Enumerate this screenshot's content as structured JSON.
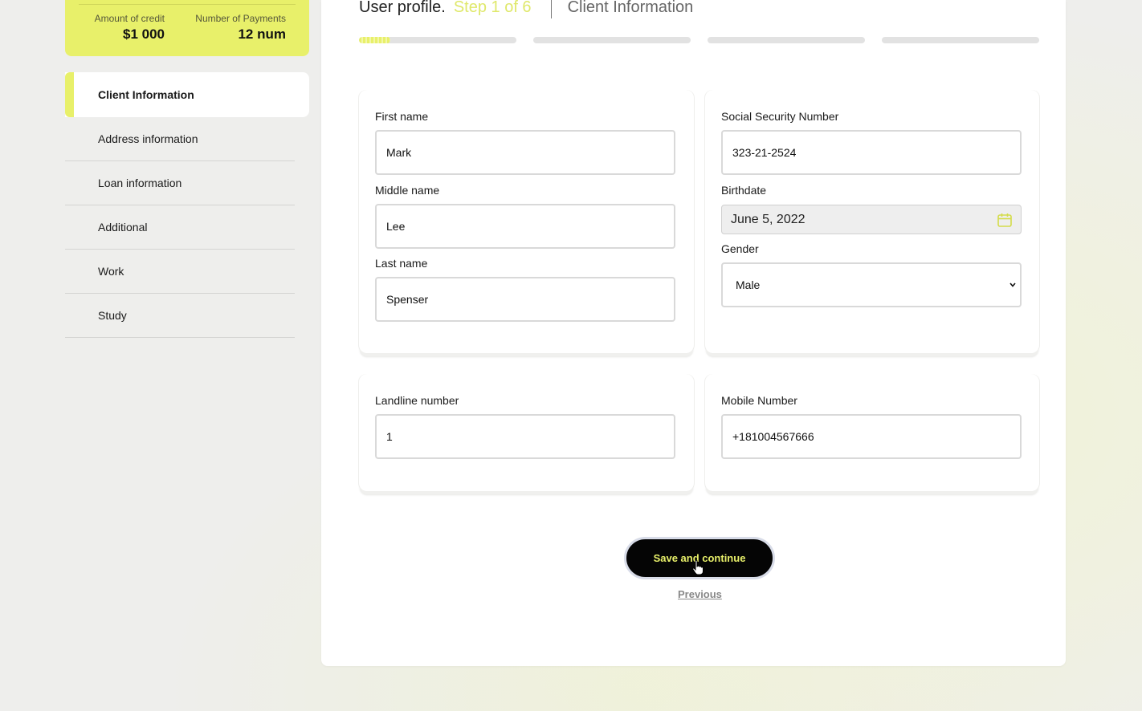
{
  "summary": {
    "amount_label": "Amount of credit",
    "amount_value": "$1 000",
    "payments_label": "Number of Payments",
    "payments_value": "12 num"
  },
  "sidebar": {
    "items": [
      {
        "label": "Client Information",
        "active": true
      },
      {
        "label": "Address information"
      },
      {
        "label": "Loan information"
      },
      {
        "label": "Additional"
      },
      {
        "label": "Work"
      },
      {
        "label": "Study"
      }
    ]
  },
  "header": {
    "title": "User profile.",
    "step": "Step 1 of 6",
    "section": "Client Information"
  },
  "progress": {
    "segments": 4,
    "current_fraction": 0.2
  },
  "form": {
    "first_name": {
      "label": "First name",
      "value": "Mark"
    },
    "middle_name": {
      "label": "Middle name",
      "value": "Lee"
    },
    "last_name": {
      "label": "Last name",
      "value": "Spenser"
    },
    "ssn": {
      "label": "Social Security Number",
      "value": "323-21-2524"
    },
    "birthdate": {
      "label": "Birthdate",
      "value": "June 5, 2022"
    },
    "gender": {
      "label": "Gender",
      "value": "Male"
    },
    "landline": {
      "label": "Landline number",
      "value": "1"
    },
    "mobile": {
      "label": "Mobile Number",
      "value": "+181004567666"
    }
  },
  "actions": {
    "save_label": "Save and continue",
    "previous_label": "Previous"
  },
  "colors": {
    "accent": "#e8f06a",
    "button_bg": "#050505"
  },
  "icons": {
    "birthdate": "calendar-icon",
    "gender": "chevron-down-icon"
  }
}
